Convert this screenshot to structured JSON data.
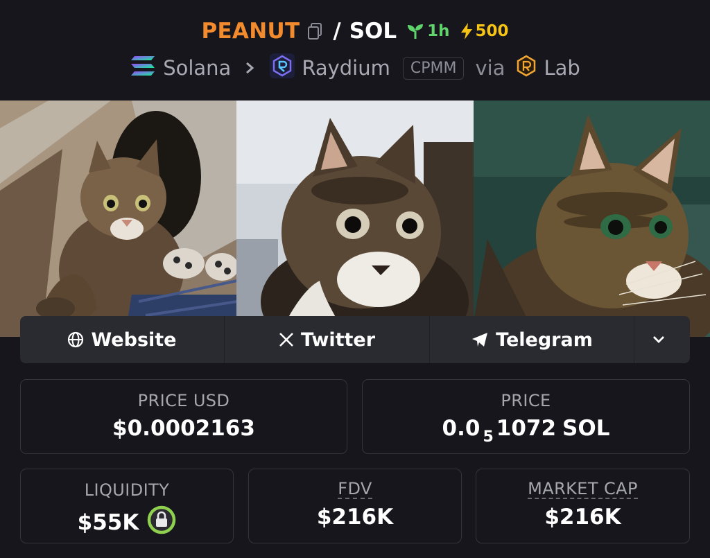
{
  "header": {
    "base_token": "PEANUT",
    "separator": "/",
    "quote_token": "SOL",
    "pair_age": "1h",
    "boost": "500",
    "icons": {
      "copy": "copy-icon",
      "age": "seedling-icon",
      "boost": "lightning-icon"
    },
    "colors": {
      "base_token": "#f28a2e",
      "age": "#5fd46a",
      "boost": "#f5c216"
    }
  },
  "route": {
    "chain": "Solana",
    "dex": "Raydium",
    "pool_type": "CPMM",
    "via_label": "via",
    "launchpad": "Lab",
    "icons": {
      "chain": "solana-logo",
      "dex": "raydium-logo",
      "launchpad": "lab-logo",
      "separator": "chevron-right-icon"
    }
  },
  "banner": {
    "description": "Three-panel tabby cat banner"
  },
  "socials": {
    "website": "Website",
    "twitter": "Twitter",
    "telegram": "Telegram",
    "icons": {
      "website": "globe-icon",
      "twitter": "x-icon",
      "telegram": "telegram-icon",
      "more": "chevron-down-icon"
    }
  },
  "stats": {
    "price_usd": {
      "label": "PRICE USD",
      "value": "$0.0002163"
    },
    "price_native": {
      "label": "PRICE",
      "prefix": "0.0",
      "zeros": "5",
      "digits": "1072",
      "unit": "SOL"
    },
    "liquidity": {
      "label": "LIQUIDITY",
      "value": "$55K",
      "icon": "lock-icon"
    },
    "fdv": {
      "label": "FDV",
      "value": "$216K"
    },
    "market_cap": {
      "label": "MARKET CAP",
      "value": "$216K"
    }
  }
}
